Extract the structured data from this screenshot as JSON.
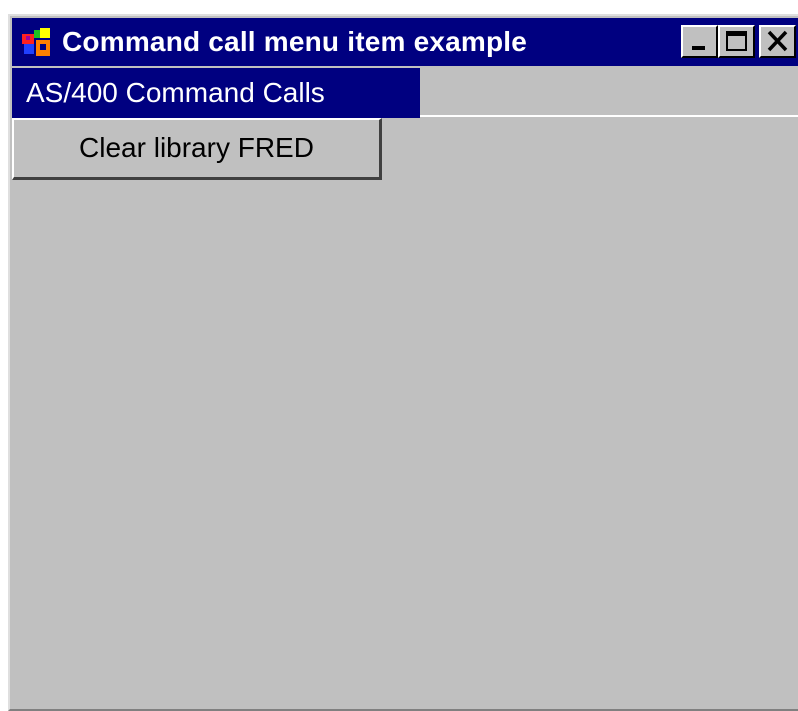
{
  "window": {
    "title": "Command call menu item example",
    "icon": "java-coffee-cup-icon",
    "controls": {
      "minimize": "minimize-icon",
      "maximize": "maximize-icon",
      "close": "close-icon"
    }
  },
  "menubar": {
    "items": [
      {
        "label": "AS/400 Command Calls"
      }
    ]
  },
  "menu": {
    "items": [
      {
        "label": "Clear library FRED"
      }
    ]
  },
  "colors": {
    "titlebar": "#000080",
    "window_background": "#c0c0c0",
    "highlight": "#000080",
    "highlight_text": "#ffffff"
  }
}
